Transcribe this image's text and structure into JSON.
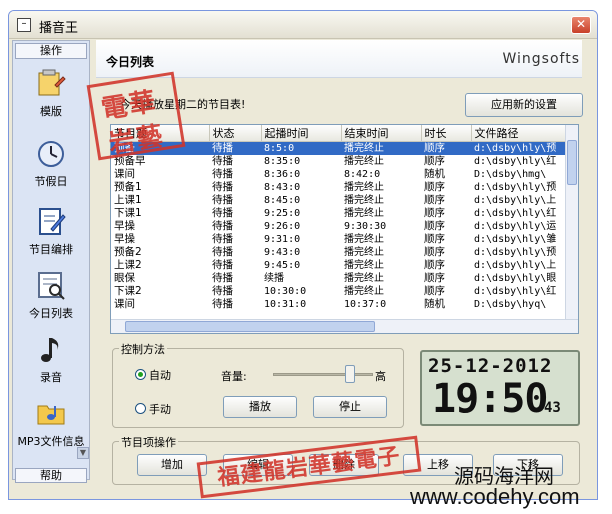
{
  "window": {
    "title": "播音王"
  },
  "sidebar": {
    "header": "操作",
    "footer": "帮助",
    "items": [
      {
        "label": "模版",
        "icon": "template-icon"
      },
      {
        "label": "节假日",
        "icon": "holiday-clock-icon"
      },
      {
        "label": "节目编排",
        "icon": "program-edit-icon"
      },
      {
        "label": "今日列表",
        "icon": "today-list-icon"
      },
      {
        "label": "录音",
        "icon": "music-note-icon"
      },
      {
        "label": "MP3文件信息",
        "icon": "mp3-folder-icon"
      }
    ]
  },
  "main": {
    "title": "今日列表",
    "brand": "Wingsofts",
    "notice": "今天播放星期二的节目表!",
    "apply_button": "应用新的设置"
  },
  "table": {
    "headers": [
      "节目题",
      "状态",
      "起播时间",
      "结束时间",
      "时长",
      "文件路径"
    ],
    "selected_index": 0,
    "rows": [
      [
        "预备",
        "待播",
        "8:5:0",
        "播完终止",
        "顺序",
        "d:\\dsby\\hly\\预"
      ],
      [
        "预备早",
        "待播",
        "8:35:0",
        "播完终止",
        "顺序",
        "d:\\dsby\\hly\\红"
      ],
      [
        "课间",
        "待播",
        "8:36:0",
        "8:42:0",
        "随机",
        "D:\\dsby\\hmg\\"
      ],
      [
        "预备1",
        "待播",
        "8:43:0",
        "播完终止",
        "顺序",
        "d:\\dsby\\hly\\预"
      ],
      [
        "上课1",
        "待播",
        "8:45:0",
        "播完终止",
        "顺序",
        "d:\\dsby\\hly\\上"
      ],
      [
        "下课1",
        "待播",
        "9:25:0",
        "播完终止",
        "顺序",
        "d:\\dsby\\hly\\红"
      ],
      [
        "早操",
        "待播",
        "9:26:0",
        "9:30:30",
        "顺序",
        "d:\\dsby\\hly\\运"
      ],
      [
        "早操",
        "待播",
        "9:31:0",
        "播完终止",
        "顺序",
        "d:\\dsby\\hly\\雏"
      ],
      [
        "预备2",
        "待播",
        "9:43:0",
        "播完终止",
        "顺序",
        "d:\\dsby\\hly\\预"
      ],
      [
        "上课2",
        "待播",
        "9:45:0",
        "播完终止",
        "顺序",
        "d:\\dsby\\hly\\上"
      ],
      [
        "眼保",
        "待播",
        "续播",
        "播完终止",
        "顺序",
        "d:\\dsby\\hly\\眼"
      ],
      [
        "下课2",
        "待播",
        "10:30:0",
        "播完终止",
        "顺序",
        "d:\\dsby\\hly\\红"
      ],
      [
        "课间",
        "待播",
        "10:31:0",
        "10:37:0",
        "随机",
        "D:\\dsby\\hyq\\"
      ]
    ]
  },
  "control": {
    "group_label": "控制方法",
    "auto_label": "自动",
    "manual_label": "手动",
    "mode": "auto",
    "volume_label": "音量:",
    "volume_high_label": "高",
    "volume_level": 0.8,
    "play_button": "播放",
    "stop_button": "停止"
  },
  "clock": {
    "date": "25-12-2012",
    "time": "19:50",
    "seconds": "43"
  },
  "operations": {
    "group_label": "节目项操作",
    "add_button": "增加",
    "edit_button": "编辑",
    "delete_button": "删除",
    "up_button": "上移",
    "down_button": "下移"
  },
  "stamps": {
    "top": [
      "電華",
      "岩藝"
    ],
    "bottom": "福建龍岩華藝電子"
  },
  "watermark": {
    "line1": "源码海洋网",
    "line2": "www.codehy.com"
  },
  "colors": {
    "selection": "#316ac5",
    "stamp": "#d1342a",
    "lcd_bg": "#d6e0cf",
    "window_bg": "#ece9d8"
  }
}
